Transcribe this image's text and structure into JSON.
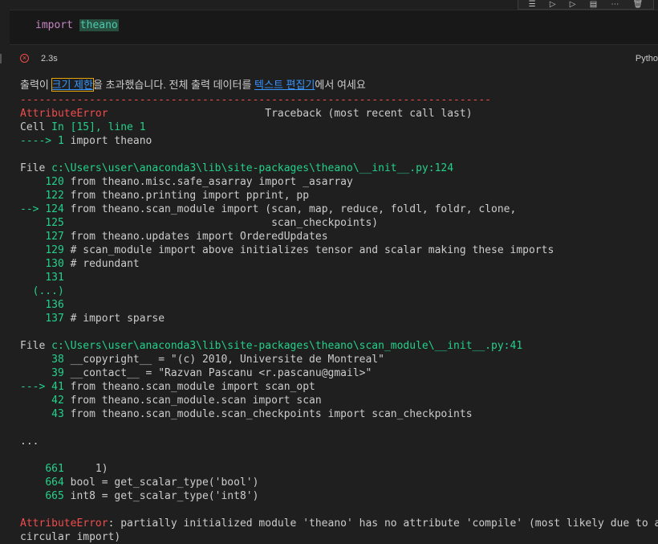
{
  "toolbar": {
    "icons": [
      "run-by-line-icon",
      "execute-above-icon",
      "execute-below-icon",
      "split-cell-icon",
      "more-icon",
      "delete-icon"
    ]
  },
  "code_cell": {
    "keyword": "import",
    "module": "theano"
  },
  "status": {
    "time": "2.3s",
    "kernel": "Pytho"
  },
  "output": {
    "truncation": {
      "prefix": "출력이 ",
      "link1": "크기 제한",
      "middle": "을 초과했습니다. 전체 출력 데이터를 ",
      "link2": "텍스트 편집기",
      "suffix": "에서 여세요"
    },
    "divider": "---------------------------------------------------------------------------",
    "header": {
      "error_name": "AttributeError",
      "traceback_label": "                         Traceback (most recent call last)"
    },
    "cell_line": {
      "cell": "Cell ",
      "in": "In [15], line 1"
    },
    "first_frame": {
      "arrow": "----> 1",
      "code": " import theano"
    },
    "frame1": {
      "file_label": "File ",
      "path": "c:\\Users\\user\\anaconda3\\lib\\site-packages\\theano\\__init__.py:124",
      "lines": [
        {
          "arrow": "    ",
          "num": "120",
          "code": " from theano.misc.safe_asarray import _asarray"
        },
        {
          "arrow": "    ",
          "num": "122",
          "code": " from theano.printing import pprint, pp"
        },
        {
          "arrow": "--> ",
          "num": "124",
          "code": " from theano.scan_module import (scan, map, reduce, foldl, foldr, clone,"
        },
        {
          "arrow": "    ",
          "num": "125",
          "code": "                                 scan_checkpoints)"
        },
        {
          "arrow": "    ",
          "num": "127",
          "code": " from theano.updates import OrderedUpdates"
        },
        {
          "arrow": "    ",
          "num": "129",
          "code": " # scan_module import above initializes tensor and scalar making these imports"
        },
        {
          "arrow": "    ",
          "num": "130",
          "code": " # redundant"
        },
        {
          "arrow": "    ",
          "num": "131",
          "code": ""
        },
        {
          "arrow": "  ",
          "num": "(...)",
          "code": ""
        },
        {
          "arrow": "    ",
          "num": "136",
          "code": ""
        },
        {
          "arrow": "    ",
          "num": "137",
          "code": " # import sparse"
        }
      ]
    },
    "frame2": {
      "file_label": "File ",
      "path": "c:\\Users\\user\\anaconda3\\lib\\site-packages\\theano\\scan_module\\__init__.py:41",
      "lines": [
        {
          "arrow": "     ",
          "num": "38",
          "code": " __copyright__ = \"(c) 2010, Universite de Montreal\""
        },
        {
          "arrow": "     ",
          "num": "39",
          "code": " __contact__ = \"Razvan Pascanu <r.pascanu@gmail>\""
        },
        {
          "arrow": "---> ",
          "num": "41",
          "code": " from theano.scan_module import scan_opt"
        },
        {
          "arrow": "     ",
          "num": "42",
          "code": " from theano.scan_module.scan import scan"
        },
        {
          "arrow": "     ",
          "num": "43",
          "code": " from theano.scan_module.scan_checkpoints import scan_checkpoints"
        }
      ]
    },
    "ellipsis": "...",
    "frame3": {
      "lines": [
        {
          "arrow": "    ",
          "num": "661",
          "code": "     1)"
        },
        {
          "arrow": "    ",
          "num": "664",
          "code": " bool = get_scalar_type('bool')"
        },
        {
          "arrow": "    ",
          "num": "665",
          "code": " int8 = get_scalar_type('int8')"
        }
      ]
    },
    "final_error": {
      "name": "AttributeError",
      "message": ": partially initialized module 'theano' has no attribute 'compile' (most likely due to a",
      "message2": "circular import)"
    }
  }
}
